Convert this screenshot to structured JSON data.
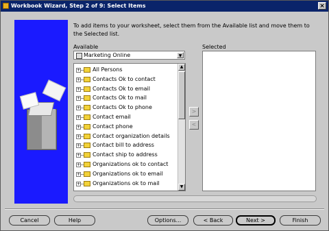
{
  "window": {
    "title": "Workbook Wizard, Step 2 of 9: Select Items",
    "close_glyph": "×"
  },
  "instructions": "To add items to your worksheet, select them from the Available list and move them to the Selected list.",
  "available": {
    "label": "Available",
    "combo_value": "Marketing Online",
    "items": [
      "All Persons",
      "Contacts Ok to contact",
      "Contacts Ok to email",
      "Contacts Ok to mail",
      "Contacts Ok to phone",
      "Contact email",
      "Contact phone",
      "Contact organization details",
      "Contact bill to address",
      "Contact ship to address",
      "Organizations ok to contact",
      "Organizations ok to email",
      "Organizations ok to mail"
    ]
  },
  "selected": {
    "label": "Selected"
  },
  "move_buttons": {
    "add": ">",
    "remove": "<"
  },
  "footer": {
    "cancel": "Cancel",
    "help": "Help",
    "options": "Options...",
    "back": "< Back",
    "next": "Next >",
    "finish": "Finish"
  }
}
